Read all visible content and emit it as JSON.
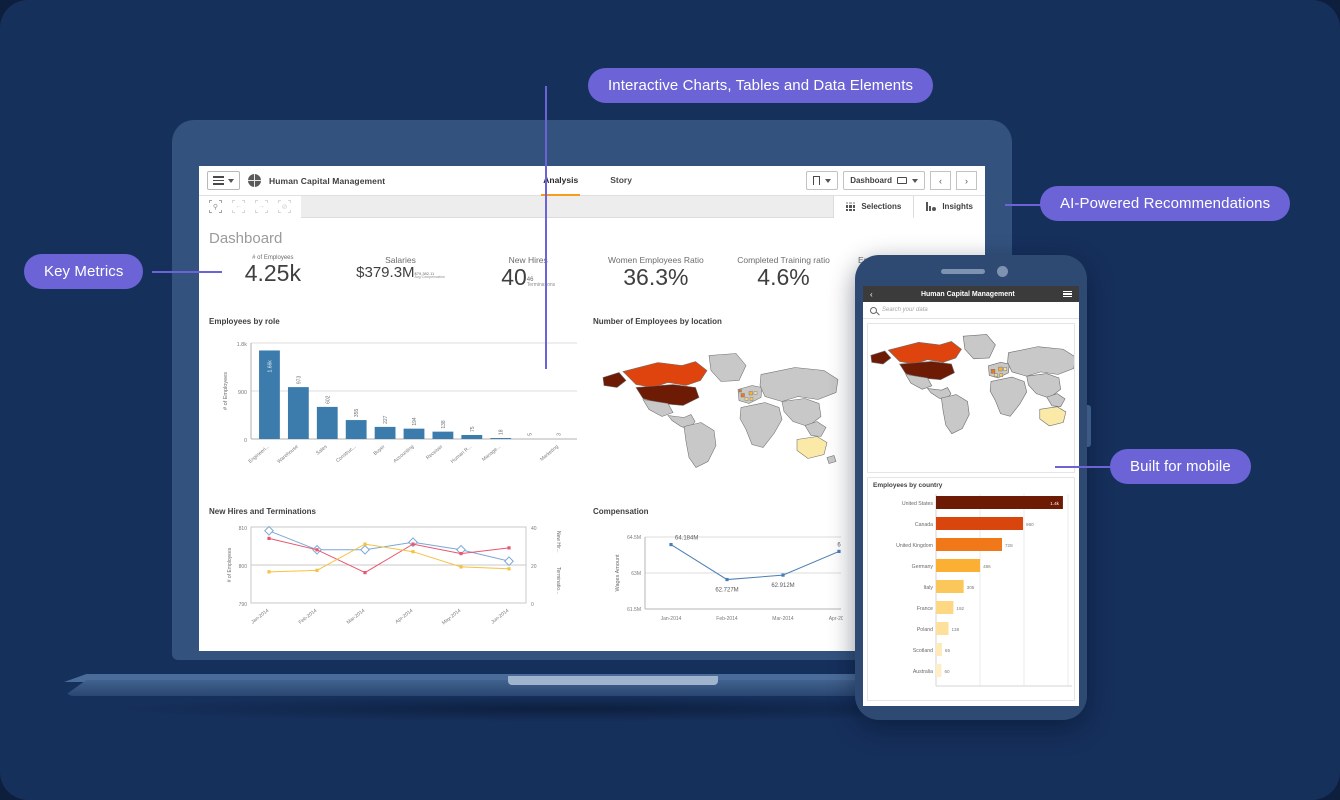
{
  "callouts": [
    {
      "id": "key-metrics",
      "label": "Key Metrics"
    },
    {
      "id": "interactive-charts",
      "label": "Interactive Charts, Tables and Data Elements"
    },
    {
      "id": "ai-recommendations",
      "label": "AI-Powered Recommendations"
    },
    {
      "id": "built-for-mobile",
      "label": "Built for mobile"
    }
  ],
  "accent": "#6b63d6",
  "background": "#16305c",
  "desktop": {
    "topbar": {
      "app_title": "Human Capital Management",
      "tabs": [
        {
          "label": "Analysis",
          "active": true
        },
        {
          "label": "Story",
          "active": false
        }
      ],
      "bookmark_label": "",
      "sheet_selector_label": "Dashboard",
      "prev_label": "‹",
      "next_label": "›"
    },
    "toolbar": {
      "selections_label": "Selections",
      "insights_label": "Insights"
    },
    "sheet_title": "Dashboard",
    "kpis": [
      {
        "label": "# of Employees",
        "value": "4.25k"
      },
      {
        "label": "Salaries",
        "value": "$379.3M",
        "sub_value": "$79,382.11",
        "sub_label": "Avg Compensation"
      },
      {
        "label": "New Hires",
        "value": "40"
      },
      {
        "label": "Terminations",
        "value": "46"
      },
      {
        "label": "Women Employees Ratio",
        "value": "36.3%"
      },
      {
        "label": "Completed Training ratio",
        "value": "4.6%"
      },
      {
        "label": "Employee Satisfaction Ratio",
        "value": ""
      }
    ],
    "panels": {
      "employees_by_role": "Employees by role",
      "employees_by_location": "Number of Employees by location",
      "new_hires_terminations": "New Hires and Terminations",
      "compensation": "Compensation"
    }
  },
  "mobile": {
    "title": "Human Capital Management",
    "back_label": "‹",
    "search_placeholder": "Search your data",
    "country_panel_title": "Employees by country"
  },
  "chart_data": [
    {
      "id": "employees-by-role",
      "type": "bar",
      "title": "Employees by role",
      "xlabel": "",
      "ylabel": "# of Employees",
      "ylim": [
        0,
        1800
      ],
      "yticks": [
        0,
        900,
        1800
      ],
      "ytick_labels": [
        "0",
        "900",
        "1.8k"
      ],
      "categories": [
        "Engineeri...",
        "Warehouse",
        "Sales",
        "Construc...",
        "Buyer",
        "Accounting",
        "Receiver",
        "Human R...",
        "Manage...",
        "",
        "Marketing"
      ],
      "values": [
        1660,
        973,
        602,
        355,
        227,
        194,
        138,
        75,
        18,
        5,
        3
      ],
      "data_labels": [
        "1.66k",
        "973",
        "602",
        "355",
        "227",
        "194",
        "138",
        "75",
        "18",
        "5",
        "3"
      ],
      "color": "#3b7cad",
      "grid": true
    },
    {
      "id": "employees-by-location",
      "type": "map",
      "title": "Number of Employees by location",
      "regions": [
        {
          "name": "United States",
          "color": "#6e1b05"
        },
        {
          "name": "Canada",
          "color": "#e0440e"
        },
        {
          "name": "Alaska",
          "color": "#6e1b05"
        },
        {
          "name": "United Kingdom",
          "color": "#f07818"
        },
        {
          "name": "Germany",
          "color": "#fbb034"
        },
        {
          "name": "Italy",
          "color": "#fcc75a"
        },
        {
          "name": "France",
          "color": "#fdd782"
        },
        {
          "name": "Poland",
          "color": "#fde09c"
        },
        {
          "name": "Australia",
          "color": "#fbe9a8"
        }
      ],
      "base_color": "#c8c8c8"
    },
    {
      "id": "new-hires-and-terminations",
      "type": "line",
      "title": "New Hires and Terminations",
      "x": [
        "Jan-2014",
        "Feb-2014",
        "Mar-2014",
        "Apr-2014",
        "May-2014",
        "Jun-2014"
      ],
      "ylabel": "# of Employees",
      "ylim": [
        790,
        810
      ],
      "yticks": [
        790,
        800,
        810
      ],
      "ytick_labels": [
        "790",
        "800",
        "810"
      ],
      "y2label": "New Hir... : Terminatio...",
      "y2lim": [
        0,
        40
      ],
      "y2ticks": [
        0,
        20,
        40
      ],
      "y2tick_labels": [
        "0",
        "20",
        "40"
      ],
      "series": [
        {
          "name": "# of Employees",
          "color": "#7ba7d7",
          "marker": "diamond-open",
          "values": [
            809,
            804,
            804,
            806,
            804,
            801
          ]
        },
        {
          "name": "New Hires",
          "color": "#e8566f",
          "marker": "square",
          "values": [
            807,
            804,
            798,
            805.5,
            803,
            804.5
          ]
        },
        {
          "name": "Terminations",
          "color": "#f5c242",
          "marker": "square",
          "values": [
            798.2,
            798.6,
            805.5,
            803.5,
            799.5,
            799
          ]
        }
      ],
      "grid": true
    },
    {
      "id": "compensation",
      "type": "line",
      "title": "Compensation",
      "ylabel": "Wages Amount",
      "ylim": [
        61500000,
        64500000
      ],
      "yticks": [
        61500000,
        63000000,
        64500000
      ],
      "ytick_labels": [
        "61.5M",
        "63M",
        "64.5M"
      ],
      "x": [
        "Jan-2014",
        "Feb-2014",
        "Mar-2014",
        "Apr-2014"
      ],
      "values": [
        64184000,
        62727000,
        62912000,
        63900000
      ],
      "data_labels": [
        "64.184M",
        "62.727M",
        "62.912M",
        "6"
      ],
      "color": "#4a7fb5",
      "grid": true
    },
    {
      "id": "employees-by-country",
      "type": "bar",
      "orientation": "horizontal",
      "title": "Employees by country",
      "categories": [
        "United States",
        "Canada",
        "United Kingdom",
        "Germany",
        "Italy",
        "France",
        "Poland",
        "Scotland",
        "Australia"
      ],
      "values": [
        1400,
        960,
        728,
        486,
        305,
        192,
        138,
        65,
        60
      ],
      "data_labels": [
        "1.4k",
        "960",
        "728",
        "486",
        "305",
        "192",
        "138",
        "65",
        "60"
      ],
      "colors": [
        "#6e1b05",
        "#d8460e",
        "#f07818",
        "#fbb034",
        "#fcc75a",
        "#fdd782",
        "#fde09c",
        "#fdeab6",
        "#fdeec6"
      ],
      "xmax": 1500
    }
  ]
}
